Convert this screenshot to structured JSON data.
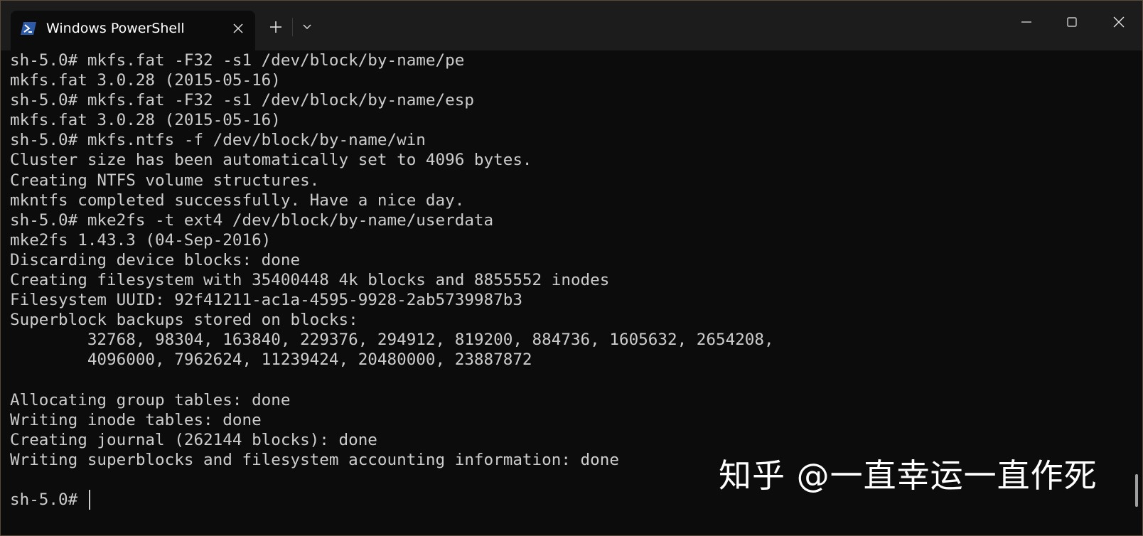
{
  "window": {
    "tab_title": "Windows PowerShell",
    "icons": {
      "tab": "powershell-icon",
      "close_tab": "close-icon",
      "new_tab": "plus-icon",
      "dropdown": "chevron-down-icon",
      "minimize": "minimize-icon",
      "maximize": "maximize-icon",
      "close_window": "close-icon"
    }
  },
  "terminal": {
    "lines": [
      "sh-5.0# mkfs.fat -F32 -s1 /dev/block/by-name/pe",
      "mkfs.fat 3.0.28 (2015-05-16)",
      "sh-5.0# mkfs.fat -F32 -s1 /dev/block/by-name/esp",
      "mkfs.fat 3.0.28 (2015-05-16)",
      "sh-5.0# mkfs.ntfs -f /dev/block/by-name/win",
      "Cluster size has been automatically set to 4096 bytes.",
      "Creating NTFS volume structures.",
      "mkntfs completed successfully. Have a nice day.",
      "sh-5.0# mke2fs -t ext4 /dev/block/by-name/userdata",
      "mke2fs 1.43.3 (04-Sep-2016)",
      "Discarding device blocks: done",
      "Creating filesystem with 35400448 4k blocks and 8855552 inodes",
      "Filesystem UUID: 92f41211-ac1a-4595-9928-2ab5739987b3",
      "Superblock backups stored on blocks:",
      "        32768, 98304, 163840, 229376, 294912, 819200, 884736, 1605632, 2654208,",
      "        4096000, 7962624, 11239424, 20480000, 23887872",
      "",
      "Allocating group tables: done",
      "Writing inode tables: done",
      "Creating journal (262144 blocks): done",
      "Writing superblocks and filesystem accounting information: done",
      ""
    ],
    "prompt": "sh-5.0# "
  },
  "watermark": "知乎 @一直幸运一直作死",
  "colors": {
    "background": "#0c0c0c",
    "titlebar": "#1c1c1c",
    "text": "#cccccc",
    "powershell_blue": "#2d5aa8"
  }
}
